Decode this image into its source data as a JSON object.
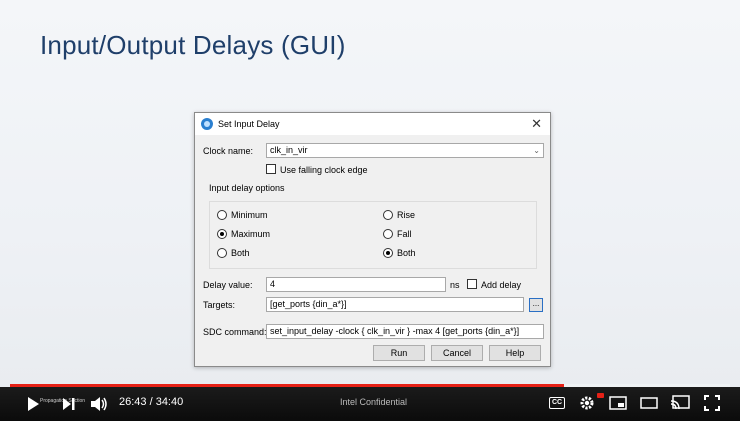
{
  "slide": {
    "title": "Input/Output Delays (GUI)"
  },
  "dialog": {
    "title": "Set Input Delay",
    "close_glyph": "✕",
    "clock_name_label": "Clock name:",
    "clock_name_value": "clk_in_vir",
    "falling_edge_label": "Use falling clock edge",
    "group_title": "Input delay options",
    "radio_left": [
      "Minimum",
      "Maximum",
      "Both"
    ],
    "radio_right": [
      "Rise",
      "Fall",
      "Both"
    ],
    "delay_value_label": "Delay value:",
    "delay_value": "4",
    "delay_unit": "ns",
    "add_delay_label": "Add delay",
    "targets_label": "Targets:",
    "targets_value": "[get_ports {din_a*}]",
    "browse_label": "...",
    "sdc_label": "SDC command:",
    "sdc_value": "set_input_delay -clock { clk_in_vir } -max 4 [get_ports {din_a*}]",
    "buttons": {
      "run": "Run",
      "cancel": "Cancel",
      "help": "Help"
    }
  },
  "player": {
    "time": "26:43 / 34:40",
    "center_text": "Intel Confidential",
    "overlay_text": "Propagation Section",
    "cc_label": "CC",
    "progress": 0.77
  }
}
